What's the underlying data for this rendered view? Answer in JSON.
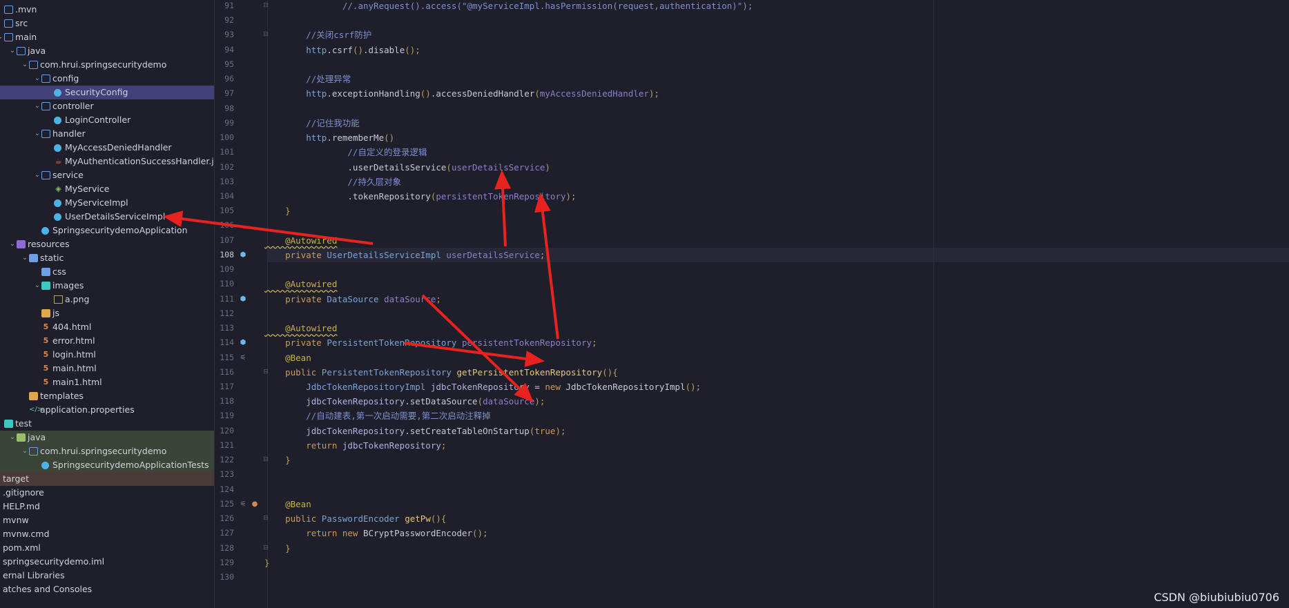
{
  "tree": [
    {
      "label": ".mvn",
      "indent": 0,
      "chev": "",
      "icon": "folder"
    },
    {
      "label": "src",
      "indent": 0,
      "chev": "",
      "icon": "folder"
    },
    {
      "label": "main",
      "indent": 0,
      "chev": "v",
      "icon": "folder"
    },
    {
      "label": "java",
      "indent": 1,
      "chev": "v",
      "icon": "folder"
    },
    {
      "label": "com.hrui.springsecuritydemo",
      "indent": 2,
      "chev": "v",
      "icon": "folder"
    },
    {
      "label": "config",
      "indent": 3,
      "chev": "v",
      "icon": "folder"
    },
    {
      "label": "SecurityConfig",
      "indent": 4,
      "chev": "",
      "icon": "class"
    },
    {
      "label": "controller",
      "indent": 3,
      "chev": "v",
      "icon": "folder"
    },
    {
      "label": "LoginController",
      "indent": 4,
      "chev": "",
      "icon": "class"
    },
    {
      "label": "handler",
      "indent": 3,
      "chev": "v",
      "icon": "folder"
    },
    {
      "label": "MyAccessDeniedHandler",
      "indent": 4,
      "chev": "",
      "icon": "class"
    },
    {
      "label": "MyAuthenticationSuccessHandler.java",
      "indent": 4,
      "chev": "",
      "icon": "java"
    },
    {
      "label": "service",
      "indent": 3,
      "chev": "v",
      "icon": "folder"
    },
    {
      "label": "MyService",
      "indent": 4,
      "chev": "",
      "icon": "interface"
    },
    {
      "label": "MyServiceImpl",
      "indent": 4,
      "chev": "",
      "icon": "class"
    },
    {
      "label": "UserDetailsServiceImpl",
      "indent": 4,
      "chev": "",
      "icon": "class"
    },
    {
      "label": "SpringsecuritydemoApplication",
      "indent": 3,
      "chev": "",
      "icon": "class"
    },
    {
      "label": "resources",
      "indent": 1,
      "chev": "v",
      "icon": "folder-purple"
    },
    {
      "label": "static",
      "indent": 2,
      "chev": "v",
      "icon": "folder-filled"
    },
    {
      "label": "css",
      "indent": 3,
      "chev": "",
      "icon": "folder-filled"
    },
    {
      "label": "images",
      "indent": 3,
      "chev": "v",
      "icon": "folder-teal"
    },
    {
      "label": "a.png",
      "indent": 4,
      "chev": "",
      "icon": "image"
    },
    {
      "label": "js",
      "indent": 3,
      "chev": "",
      "icon": "folder-orange"
    },
    {
      "label": "404.html",
      "indent": 3,
      "chev": "",
      "icon": "html"
    },
    {
      "label": "error.html",
      "indent": 3,
      "chev": "",
      "icon": "html"
    },
    {
      "label": "login.html",
      "indent": 3,
      "chev": "",
      "icon": "html"
    },
    {
      "label": "main.html",
      "indent": 3,
      "chev": "",
      "icon": "html"
    },
    {
      "label": "main1.html",
      "indent": 3,
      "chev": "",
      "icon": "html"
    },
    {
      "label": "templates",
      "indent": 2,
      "chev": "",
      "icon": "folder-orange"
    },
    {
      "label": "application.properties",
      "indent": 2,
      "chev": "",
      "icon": "props"
    },
    {
      "label": "test",
      "indent": 0,
      "chev": "",
      "icon": "folder-teal"
    },
    {
      "label": "java",
      "indent": 1,
      "chev": "v",
      "icon": "folder-green"
    },
    {
      "label": "com.hrui.springsecuritydemo",
      "indent": 2,
      "chev": "v",
      "icon": "folder"
    },
    {
      "label": "SpringsecuritydemoApplicationTests",
      "indent": 3,
      "chev": "",
      "icon": "class"
    },
    {
      "label": "target",
      "indent": 0,
      "chev": "",
      "icon": ""
    },
    {
      "label": ".gitignore",
      "indent": 0,
      "chev": "",
      "icon": ""
    },
    {
      "label": "HELP.md",
      "indent": 0,
      "chev": "",
      "icon": ""
    },
    {
      "label": "mvnw",
      "indent": 0,
      "chev": "",
      "icon": ""
    },
    {
      "label": "mvnw.cmd",
      "indent": 0,
      "chev": "",
      "icon": ""
    },
    {
      "label": "pom.xml",
      "indent": 0,
      "chev": "",
      "icon": ""
    },
    {
      "label": "springsecuritydemo.iml",
      "indent": 0,
      "chev": "",
      "icon": ""
    },
    {
      "label": "ernal Libraries",
      "indent": 0,
      "chev": "",
      "icon": ""
    },
    {
      "label": "atches and Consoles",
      "indent": 0,
      "chev": "",
      "icon": ""
    }
  ],
  "selected_tree_item": "SecurityConfig",
  "current_line": "108",
  "code": [
    {
      "n": "91",
      "t": [
        [
          "cm",
          "               //.anyRequest().access(\"@myServiceImpl.hasPermission(request,authentication)\");"
        ]
      ],
      "fold": "-"
    },
    {
      "n": "92",
      "t": []
    },
    {
      "n": "93",
      "t": [
        [
          "cm",
          "        //关闭csrf防护"
        ]
      ],
      "fold": "-"
    },
    {
      "n": "94",
      "t": [
        [
          "ty",
          "        http"
        ],
        [
          "mt",
          ".csrf"
        ],
        [
          "br",
          "()"
        ],
        [
          "mt",
          ".disable"
        ],
        [
          "br",
          "()"
        ],
        [
          "kw",
          ";"
        ]
      ]
    },
    {
      "n": "95",
      "t": []
    },
    {
      "n": "96",
      "t": [
        [
          "cm",
          "        //处理异常"
        ]
      ]
    },
    {
      "n": "97",
      "t": [
        [
          "ty",
          "        http"
        ],
        [
          "mt",
          ".exceptionHandling"
        ],
        [
          "br",
          "()"
        ],
        [
          "mt",
          ".accessDeniedHandler"
        ],
        [
          "br",
          "("
        ],
        [
          "fld",
          "myAccessDeniedHandler"
        ],
        [
          "br",
          ")"
        ],
        [
          "kw",
          ";"
        ]
      ]
    },
    {
      "n": "98",
      "t": []
    },
    {
      "n": "99",
      "t": [
        [
          "cm",
          "        //记住我功能"
        ]
      ]
    },
    {
      "n": "100",
      "t": [
        [
          "ty",
          "        http"
        ],
        [
          "mt",
          ".rememberMe"
        ],
        [
          "br",
          "()"
        ]
      ]
    },
    {
      "n": "101",
      "t": [
        [
          "cm",
          "                //自定义的登录逻辑"
        ]
      ]
    },
    {
      "n": "102",
      "t": [
        [
          "mt",
          "                .userDetailsService"
        ],
        [
          "br",
          "("
        ],
        [
          "fld",
          "userDetailsService"
        ],
        [
          "br",
          ")"
        ]
      ]
    },
    {
      "n": "103",
      "t": [
        [
          "cm",
          "                //持久层对象"
        ]
      ]
    },
    {
      "n": "104",
      "t": [
        [
          "mt",
          "                .tokenRepository"
        ],
        [
          "br",
          "("
        ],
        [
          "fld",
          "persistentTokenRepository"
        ],
        [
          "br",
          ")"
        ],
        [
          "kw",
          ";"
        ]
      ]
    },
    {
      "n": "105",
      "t": [
        [
          "br",
          "    }"
        ]
      ]
    },
    {
      "n": "106",
      "t": []
    },
    {
      "n": "107",
      "t": [
        [
          "an",
          "    @Autowired"
        ]
      ]
    },
    {
      "n": "108",
      "t": [
        [
          "kw",
          "    private "
        ],
        [
          "ty",
          "UserDetailsServiceImpl "
        ],
        [
          "fld",
          "userDetailsService"
        ],
        [
          "kw",
          ";"
        ]
      ],
      "gicon": "bean"
    },
    {
      "n": "109",
      "t": []
    },
    {
      "n": "110",
      "t": [
        [
          "an",
          "    @Autowired"
        ]
      ]
    },
    {
      "n": "111",
      "t": [
        [
          "kw",
          "    private "
        ],
        [
          "ty",
          "DataSource "
        ],
        [
          "fld",
          "dataSource"
        ],
        [
          "kw",
          ";"
        ]
      ],
      "gicon": "bean"
    },
    {
      "n": "112",
      "t": []
    },
    {
      "n": "113",
      "t": [
        [
          "an",
          "    @Autowired"
        ]
      ]
    },
    {
      "n": "114",
      "t": [
        [
          "kw",
          "    private "
        ],
        [
          "ty",
          "PersistentTokenRepository "
        ],
        [
          "fld",
          "persistentTokenRepository"
        ],
        [
          "kw",
          ";"
        ]
      ],
      "gicon": "bean"
    },
    {
      "n": "115",
      "t": [
        [
          "an2",
          "    @Bean"
        ]
      ],
      "gicon": "list"
    },
    {
      "n": "116",
      "t": [
        [
          "kw",
          "    public "
        ],
        [
          "ty",
          "PersistentTokenRepository "
        ],
        [
          "fn",
          "getPersistentTokenRepository"
        ],
        [
          "br",
          "(){"
        ]
      ],
      "fold": "-"
    },
    {
      "n": "117",
      "t": [
        [
          "ty",
          "        JdbcTokenRepositoryImpl "
        ],
        [
          "var",
          "jdbcTokenRepository "
        ],
        [
          "mt",
          "= "
        ],
        [
          "kw",
          "new "
        ],
        [
          "mt",
          "JdbcTokenRepositoryImpl"
        ],
        [
          "br",
          "()"
        ],
        [
          "kw",
          ";"
        ]
      ]
    },
    {
      "n": "118",
      "t": [
        [
          "var",
          "        jdbcTokenRepository"
        ],
        [
          "mt",
          ".setDataSource"
        ],
        [
          "br",
          "("
        ],
        [
          "fld",
          "dataSource"
        ],
        [
          "br",
          ")"
        ],
        [
          "kw",
          ";"
        ]
      ]
    },
    {
      "n": "119",
      "t": [
        [
          "cm",
          "        //自动建表,第一次启动需要,第二次启动注释掉"
        ]
      ]
    },
    {
      "n": "120",
      "t": [
        [
          "var",
          "        jdbcTokenRepository"
        ],
        [
          "mt",
          ".setCreateTableOnStartup"
        ],
        [
          "br",
          "("
        ],
        [
          "num",
          "true"
        ],
        [
          "br",
          ")"
        ],
        [
          "kw",
          ";"
        ]
      ]
    },
    {
      "n": "121",
      "t": [
        [
          "kw",
          "        return "
        ],
        [
          "var",
          "jdbcTokenRepository"
        ],
        [
          "kw",
          ";"
        ]
      ]
    },
    {
      "n": "122",
      "t": [
        [
          "br",
          "    }"
        ]
      ],
      "fold": "-"
    },
    {
      "n": "123",
      "t": []
    },
    {
      "n": "124",
      "t": []
    },
    {
      "n": "125",
      "t": [
        [
          "an2",
          "    @Bean"
        ]
      ],
      "gicon": "list2"
    },
    {
      "n": "126",
      "t": [
        [
          "kw",
          "    public "
        ],
        [
          "ty",
          "PasswordEncoder "
        ],
        [
          "fn",
          "getPw"
        ],
        [
          "br",
          "(){"
        ]
      ],
      "fold": "-"
    },
    {
      "n": "127",
      "t": [
        [
          "kw",
          "        return new "
        ],
        [
          "mt",
          "BCryptPasswordEncoder"
        ],
        [
          "br",
          "()"
        ],
        [
          "kw",
          ";"
        ]
      ]
    },
    {
      "n": "128",
      "t": [
        [
          "br",
          "    }"
        ]
      ],
      "fold": "-"
    },
    {
      "n": "129",
      "t": [
        [
          "br",
          "}"
        ]
      ]
    },
    {
      "n": "130",
      "t": []
    }
  ],
  "watermark": "CSDN @biubiubiu0706",
  "colors": {
    "arrow": "#e8231f",
    "selection": "#42417a",
    "background": "#1e1f2a"
  }
}
